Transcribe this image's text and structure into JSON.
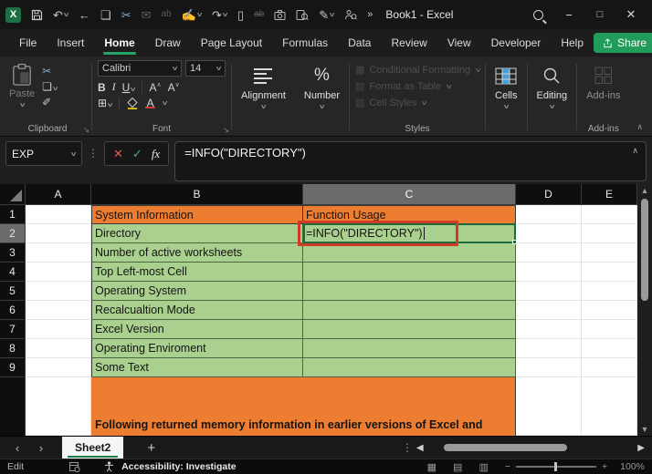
{
  "titlebar": {
    "title": "Book1  -  Excel"
  },
  "tabs": {
    "items": [
      "File",
      "Insert",
      "Home",
      "Draw",
      "Page Layout",
      "Formulas",
      "Data",
      "Review",
      "View",
      "Developer",
      "Help"
    ],
    "active": "Home",
    "share_label": "Share"
  },
  "ribbon": {
    "paste_label": "Paste",
    "font_name": "Calibri",
    "font_size": "14",
    "bold": "B",
    "italic": "I",
    "underline": "U",
    "font_color_letter": "A",
    "grow_font": "A",
    "shrink_font": "A",
    "groups": {
      "clipboard": "Clipboard",
      "font": "Font",
      "alignment": "Alignment",
      "number": "Number",
      "styles": "Styles",
      "cells": "Cells",
      "editing": "Editing",
      "addins": "Add-ins"
    },
    "styles_items": [
      "Conditional Formatting",
      "Format as Table",
      "Cell Styles"
    ],
    "addins_button": "Add-ins",
    "number_symbol": "%"
  },
  "formula_bar": {
    "name_box": "EXP",
    "fx": "fx",
    "formula": "=INFO(\"DIRECTORY\")"
  },
  "grid": {
    "col_headers": [
      "A",
      "B",
      "C",
      "D",
      "E"
    ],
    "row_headers": [
      "1",
      "2",
      "3",
      "4",
      "5",
      "6",
      "7",
      "8",
      "9"
    ],
    "rows": [
      {
        "label": "System Information",
        "value": "Function Usage"
      },
      {
        "label": "Directory",
        "value": "=INFO(\"DIRECTORY\")"
      },
      {
        "label": "Number of active worksheets",
        "value": ""
      },
      {
        "label": "Top Left-most Cell",
        "value": ""
      },
      {
        "label": "Operating System",
        "value": ""
      },
      {
        "label": "Recalcualtion Mode",
        "value": ""
      },
      {
        "label": "Excel Version",
        "value": ""
      },
      {
        "label": "Operating Enviroment",
        "value": ""
      },
      {
        "label": "Some Text",
        "value": ""
      }
    ],
    "banner_text": "Following returned memory information in earlier versions of Excel and"
  },
  "sheet_bar": {
    "active_tab": "Sheet2"
  },
  "status_bar": {
    "mode": "Edit",
    "accessibility": "Accessibility: Investigate",
    "zoom_level": "100%"
  },
  "colors": {
    "accent_green": "#21a366",
    "header_orange": "#ED7D31",
    "cell_green": "#A9D08E",
    "annotation_red": "#D03A26"
  }
}
